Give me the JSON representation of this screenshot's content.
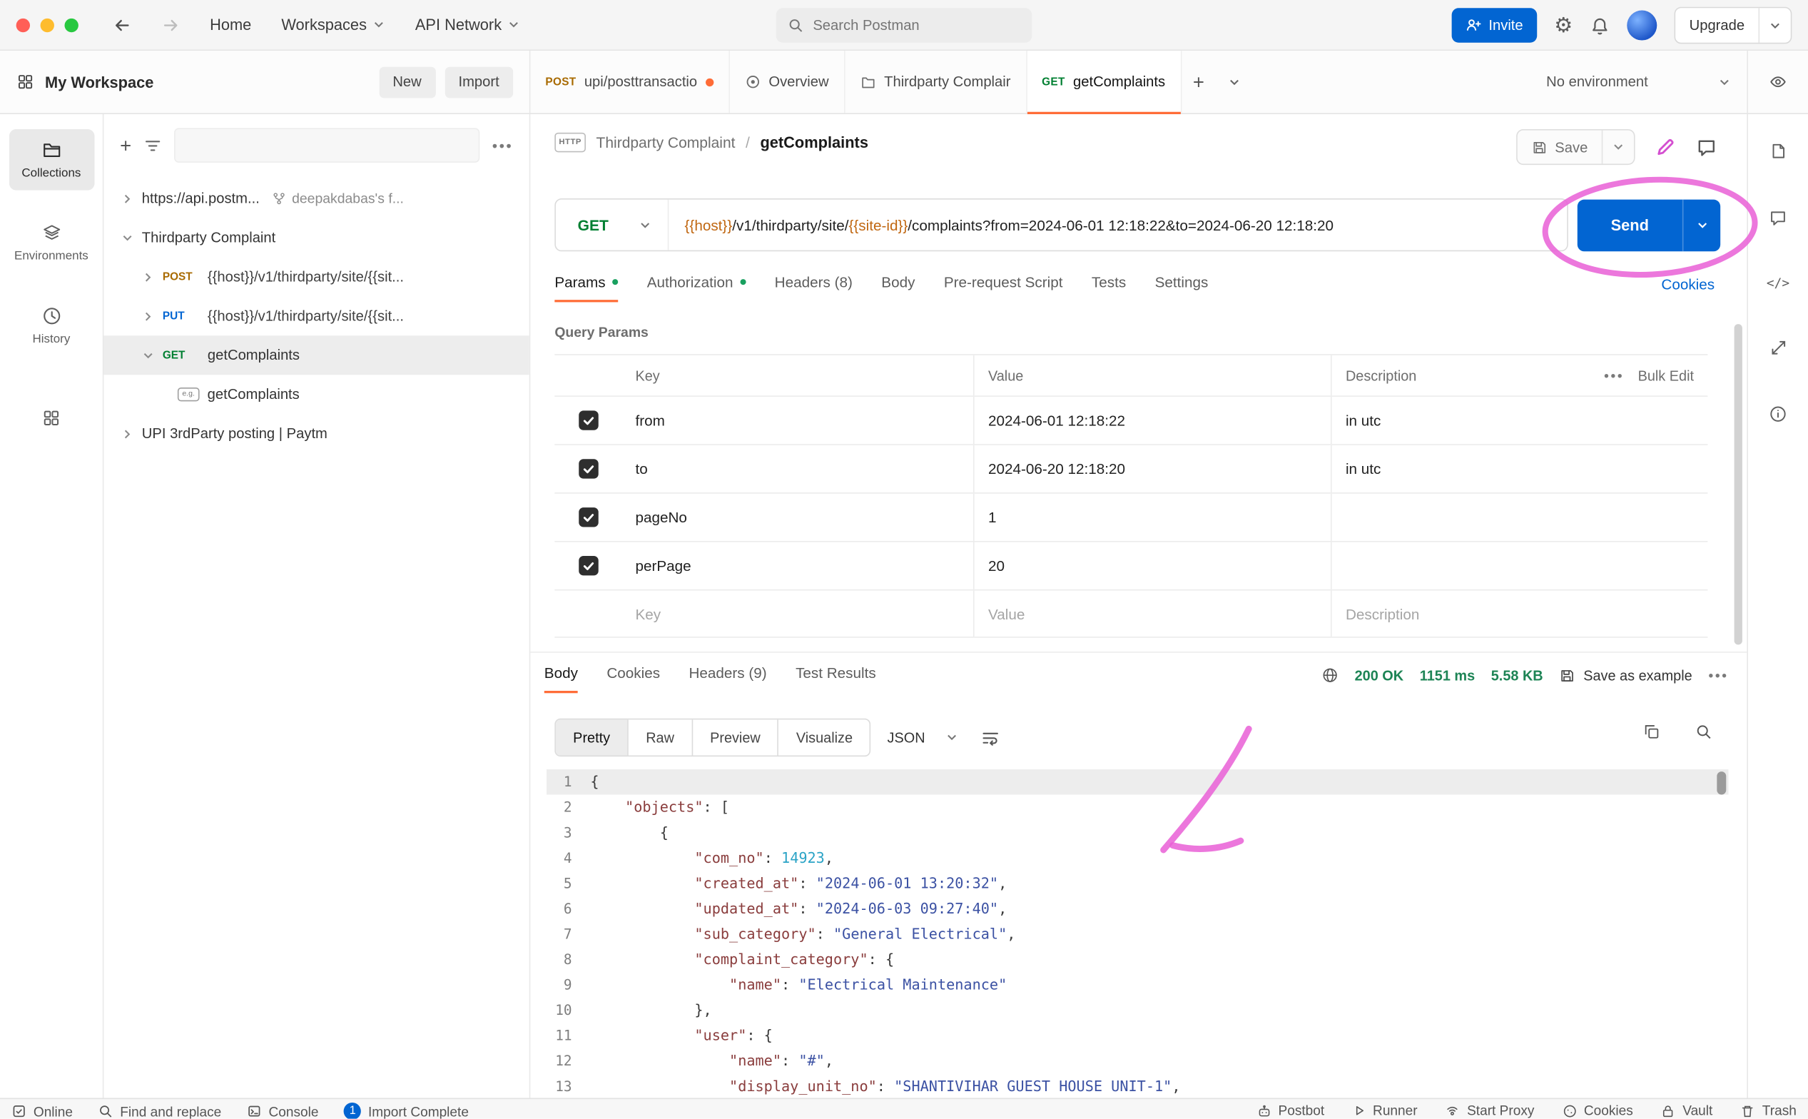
{
  "colors": {
    "primary_blue": "#0265d2",
    "accent_orange": "#ff6c37",
    "method_get_green": "#007f31",
    "method_post_amber": "#a86a00",
    "method_put_blue": "#0265d2",
    "success_green": "#1d8455",
    "annotation_pink": "#e95fd6",
    "template_variable_orange": "#c06711"
  },
  "topbar": {
    "menu": [
      "Home",
      "Workspaces",
      "API Network"
    ],
    "search_placeholder": "Search Postman",
    "invite": "Invite",
    "upgrade": "Upgrade"
  },
  "tabs_bar": {
    "workspace_title": "My Workspace",
    "new": "New",
    "import": "Import",
    "tab1_method": "POST",
    "tab1_label": "upi/posttransactio",
    "tab2_label": "Overview",
    "tab3_label": "Thirdparty Complair",
    "tab4_method": "GET",
    "tab4_label": "getComplaints",
    "environment": "No environment"
  },
  "rail": {
    "collections": "Collections",
    "environments": "Environments",
    "history": "History"
  },
  "sidebar": {
    "root_api": "https://api.postm...",
    "root_fork": "deepakdabas's f...",
    "collection1": "Thirdparty Complaint",
    "post_label": "POST",
    "post_path": "{{host}}/v1/thirdparty/site/{{sit...",
    "put_label": "PUT",
    "put_path": "{{host}}/v1/thirdparty/site/{{sit...",
    "get_label": "GET",
    "get_name": "getComplaints",
    "example_badge": "e.g.",
    "example_name": "getComplaints",
    "collection2": "UPI 3rdParty posting | Paytm"
  },
  "request": {
    "http_badge": "HTTP",
    "breadcrumb_parent": "Thirdparty Complaint",
    "breadcrumb_separator": "/",
    "breadcrumb_current": "getComplaints",
    "save": "Save",
    "method": "GET",
    "url_var1": "{{host}}",
    "url_text1": "/v1/thirdparty/site/",
    "url_var2": "{{site-id}}",
    "url_text2": "/complaints?from=2024-06-01 12:18:22&to=2024-06-20 12:18:20",
    "send": "Send",
    "tab_params": "Params",
    "tab_auth": "Authorization",
    "tab_headers": "Headers (8)",
    "tab_body": "Body",
    "tab_prerequest": "Pre-request Script",
    "tab_tests": "Tests",
    "tab_settings": "Settings",
    "cookies_link": "Cookies",
    "section_title": "Query Params",
    "col_key": "Key",
    "col_value": "Value",
    "col_description": "Description",
    "bulk_edit": "Bulk Edit",
    "rows": [
      {
        "key": "from",
        "value": "2024-06-01 12:18:22",
        "description": "in utc"
      },
      {
        "key": "to",
        "value": "2024-06-20 12:18:20",
        "description": "in utc"
      },
      {
        "key": "pageNo",
        "value": "1",
        "description": ""
      },
      {
        "key": "perPage",
        "value": "20",
        "description": ""
      }
    ],
    "placeholder_key": "Key",
    "placeholder_value": "Value",
    "placeholder_description": "Description"
  },
  "response": {
    "tab_body": "Body",
    "tab_cookies": "Cookies",
    "tab_headers": "Headers (9)",
    "tab_tests": "Test Results",
    "status": "200 OK",
    "time": "1151 ms",
    "size": "5.58 KB",
    "save_as_example": "Save as example",
    "view_pretty": "Pretty",
    "view_raw": "Raw",
    "view_preview": "Preview",
    "view_visualize": "Visualize",
    "format": "JSON",
    "code_lines": [
      [
        {
          "c": "p",
          "v": "{"
        }
      ],
      [
        {
          "c": "p",
          "v": "    "
        },
        {
          "c": "k",
          "v": "\"objects\""
        },
        {
          "c": "p",
          "v": ": ["
        }
      ],
      [
        {
          "c": "p",
          "v": "        {"
        }
      ],
      [
        {
          "c": "p",
          "v": "            "
        },
        {
          "c": "k",
          "v": "\"com_no\""
        },
        {
          "c": "p",
          "v": ": "
        },
        {
          "c": "n",
          "v": "14923"
        },
        {
          "c": "p",
          "v": ","
        }
      ],
      [
        {
          "c": "p",
          "v": "            "
        },
        {
          "c": "k",
          "v": "\"created_at\""
        },
        {
          "c": "p",
          "v": ": "
        },
        {
          "c": "s",
          "v": "\"2024-06-01 13:20:32\""
        },
        {
          "c": "p",
          "v": ","
        }
      ],
      [
        {
          "c": "p",
          "v": "            "
        },
        {
          "c": "k",
          "v": "\"updated_at\""
        },
        {
          "c": "p",
          "v": ": "
        },
        {
          "c": "s",
          "v": "\"2024-06-03 09:27:40\""
        },
        {
          "c": "p",
          "v": ","
        }
      ],
      [
        {
          "c": "p",
          "v": "            "
        },
        {
          "c": "k",
          "v": "\"sub_category\""
        },
        {
          "c": "p",
          "v": ": "
        },
        {
          "c": "s",
          "v": "\"General Electrical\""
        },
        {
          "c": "p",
          "v": ","
        }
      ],
      [
        {
          "c": "p",
          "v": "            "
        },
        {
          "c": "k",
          "v": "\"complaint_category\""
        },
        {
          "c": "p",
          "v": ": {"
        }
      ],
      [
        {
          "c": "p",
          "v": "                "
        },
        {
          "c": "k",
          "v": "\"name\""
        },
        {
          "c": "p",
          "v": ": "
        },
        {
          "c": "s",
          "v": "\"Electrical Maintenance\""
        }
      ],
      [
        {
          "c": "p",
          "v": "            },"
        }
      ],
      [
        {
          "c": "p",
          "v": "            "
        },
        {
          "c": "k",
          "v": "\"user\""
        },
        {
          "c": "p",
          "v": ": {"
        }
      ],
      [
        {
          "c": "p",
          "v": "                "
        },
        {
          "c": "k",
          "v": "\"name\""
        },
        {
          "c": "p",
          "v": ": "
        },
        {
          "c": "s",
          "v": "\"#\""
        },
        {
          "c": "p",
          "v": ","
        }
      ],
      [
        {
          "c": "p",
          "v": "                "
        },
        {
          "c": "k",
          "v": "\"display_unit_no\""
        },
        {
          "c": "p",
          "v": ": "
        },
        {
          "c": "s",
          "v": "\"SHANTIVIHAR GUEST HOUSE UNIT-1\""
        },
        {
          "c": "p",
          "v": ","
        }
      ]
    ]
  },
  "status_bar": {
    "online": "Online",
    "find": "Find and replace",
    "console": "Console",
    "import_badge": "1",
    "import_complete": "Import Complete",
    "postbot": "Postbot",
    "runner": "Runner",
    "start_proxy": "Start Proxy",
    "cookies": "Cookies",
    "vault": "Vault",
    "trash": "Trash"
  }
}
